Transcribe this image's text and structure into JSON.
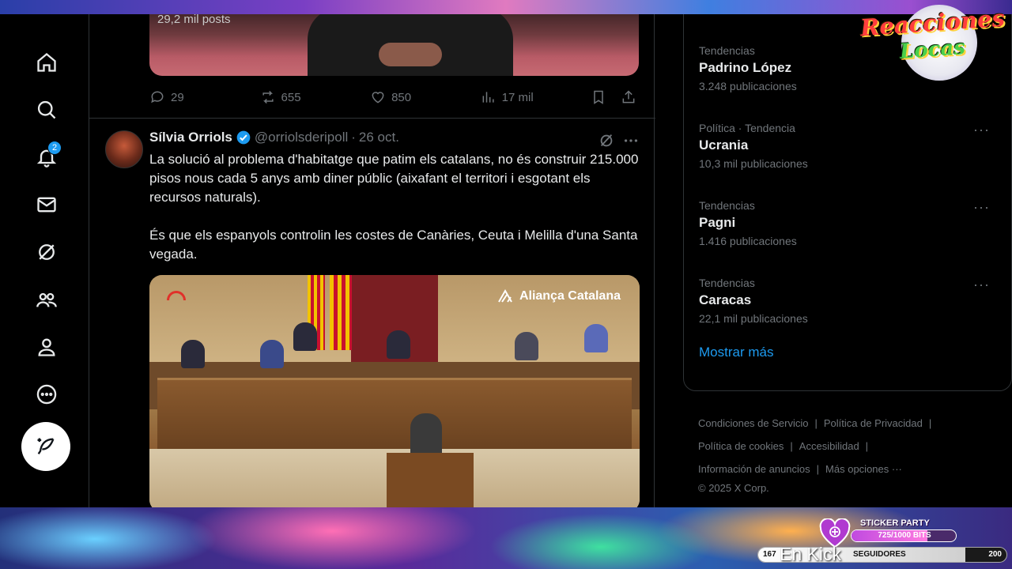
{
  "nav": {
    "notifications_badge": "2",
    "items": [
      "home-icon",
      "search-icon",
      "bell-icon",
      "mail-icon",
      "grok-icon",
      "communities-icon",
      "profile-icon",
      "more-icon"
    ]
  },
  "previous_post": {
    "media_caption": "29,2 mil posts",
    "replies": "29",
    "reposts": "655",
    "likes": "850",
    "views": "17 mil"
  },
  "post": {
    "author": "Sílvia Orriols",
    "handle": "@orriolsderipoll",
    "separator": "·",
    "date": "26 oct.",
    "paragraph1": "La solució al problema d'habitatge que patim els catalans, no és construir 215.000 pisos nous cada 5 anys amb diner públic (aixafant el territori i esgotant els recursos naturals).",
    "paragraph2": "És que els espanyols controlin les costes de Canàries, Ceuta i Melilla d'una Santa vegada.",
    "video_watermark": "Aliança Catalana"
  },
  "trends": [
    {
      "category": "Tendencias",
      "name": "Padrino López",
      "count": "3.248 publicaciones"
    },
    {
      "category": "Política · Tendencia",
      "name": "Ucrania",
      "count": "10,3 mil publicaciones"
    },
    {
      "category": "Tendencias",
      "name": "Pagni",
      "count": "1.416 publicaciones"
    },
    {
      "category": "Tendencias",
      "name": "Caracas",
      "count": "22,1 mil publicaciones"
    }
  ],
  "show_more": "Mostrar más",
  "footer": {
    "terms": "Condiciones de Servicio",
    "privacy": "Política de Privacidad",
    "cookies": "Política de cookies",
    "accessibility": "Accesibilidad",
    "ads_info": "Información de anuncios",
    "more_options": "Más opciones ···",
    "copyright": "© 2025 X Corp."
  },
  "overlay": {
    "logo_line1": "Reacciones",
    "logo_line2": "Locas",
    "sticker_title": "STICKER PARTY",
    "sticker_progress": "725/1000 BITS",
    "sticker_fraction": 0.725,
    "followers_current": "167",
    "followers_label": "SEGUIDORES",
    "followers_goal": "200",
    "followers_fraction": 0.835,
    "platform_text": "En Kick"
  },
  "colors": {
    "accent": "#1d9bf0",
    "background": "#000000",
    "secondary_text": "#71767b"
  }
}
